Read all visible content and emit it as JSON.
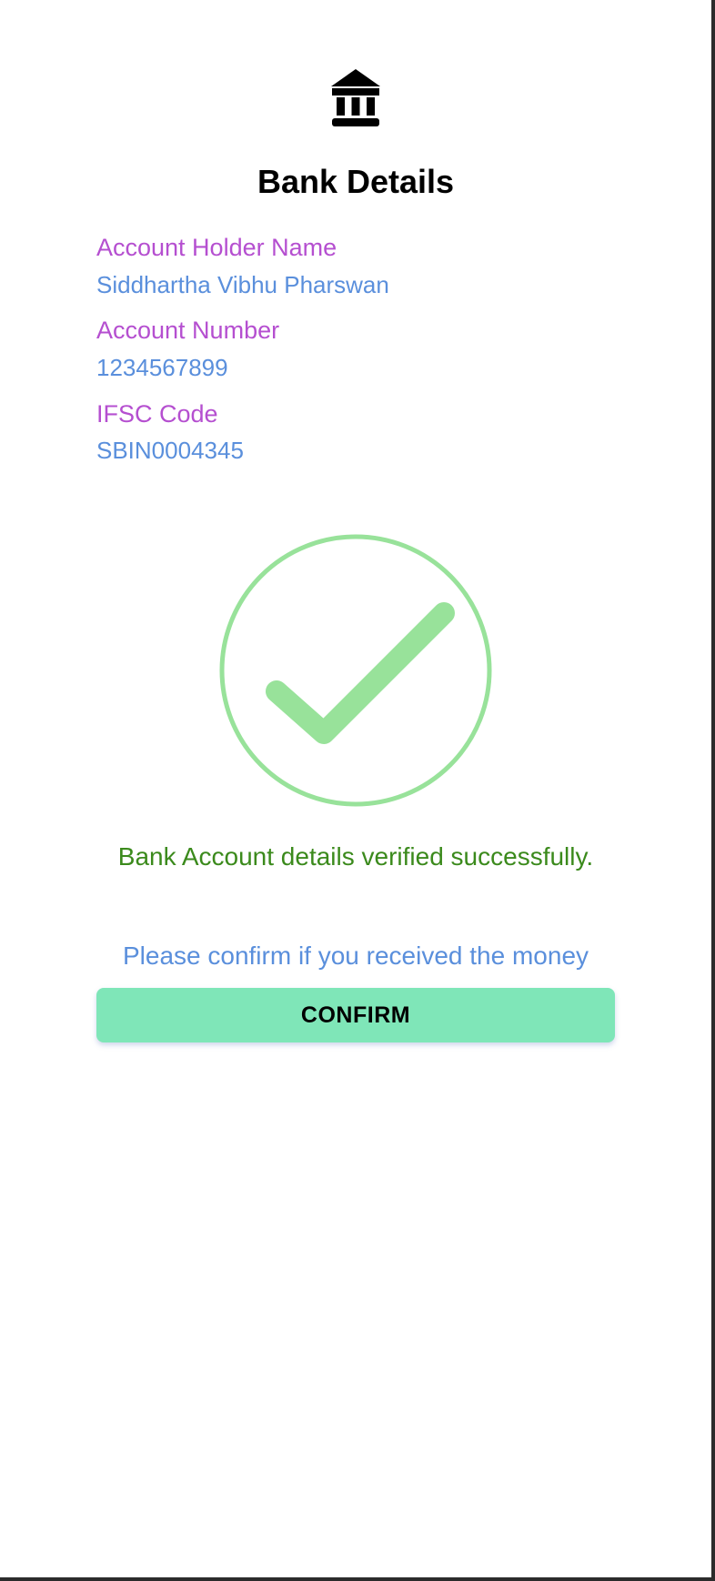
{
  "header": {
    "icon": "bank-icon",
    "title": "Bank Details"
  },
  "details": {
    "holder_name_label": "Account Holder Name",
    "holder_name_value": "Siddhartha Vibhu Pharswan",
    "account_number_label": "Account Number",
    "account_number_value": "1234567899",
    "ifsc_label": "IFSC Code",
    "ifsc_value": "SBIN0004345"
  },
  "status": {
    "icon": "check-circle-icon",
    "message": "Bank Account details verified successfully."
  },
  "confirmation": {
    "prompt": "Please confirm if you received the money",
    "button_label": "CONFIRM"
  },
  "colors": {
    "label": "#b54fd0",
    "value": "#5a8fdc",
    "success_text": "#3b8a1c",
    "check": "#98e29a",
    "button": "#7fe6b8",
    "prompt": "#5a8fdc"
  }
}
